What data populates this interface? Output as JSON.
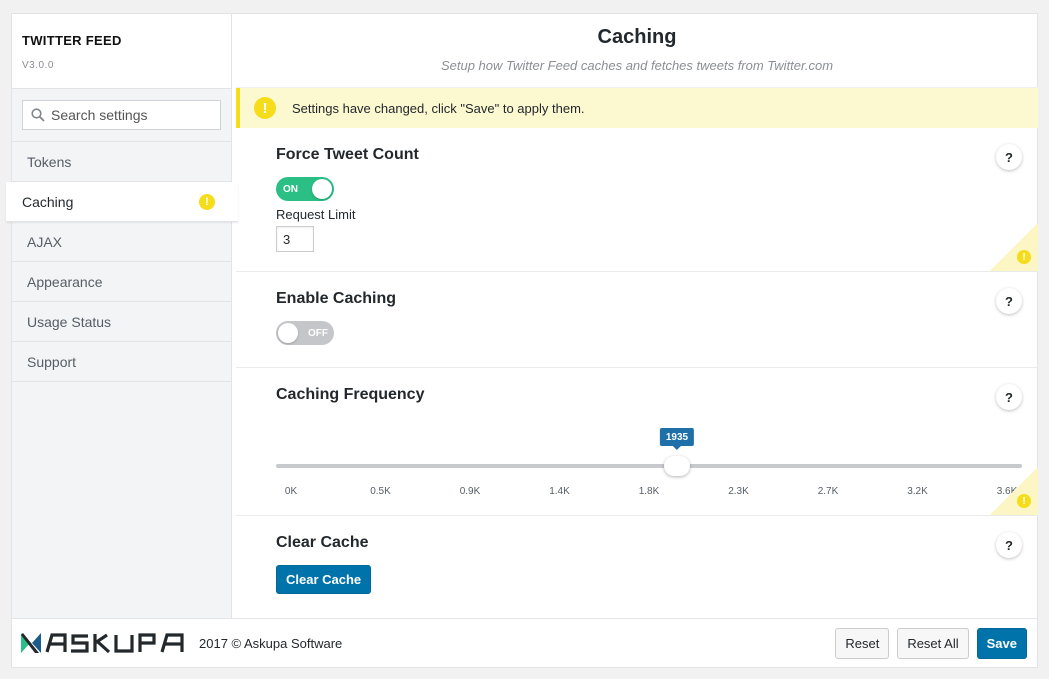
{
  "brand": {
    "title": "TWITTER FEED",
    "version": "V3.0.0"
  },
  "search": {
    "placeholder": "Search settings"
  },
  "sidebar": {
    "items": [
      {
        "label": "Tokens",
        "active": false
      },
      {
        "label": "Caching",
        "active": true,
        "warning": true
      },
      {
        "label": "AJAX",
        "active": false
      },
      {
        "label": "Appearance",
        "active": false
      },
      {
        "label": "Usage Status",
        "active": false
      },
      {
        "label": "Support",
        "active": false
      }
    ]
  },
  "header": {
    "title": "Caching",
    "subtitle": "Setup how Twitter Feed caches and fetches tweets from Twitter.com"
  },
  "notice": {
    "text": "Settings have changed, click \"Save\" to apply them.",
    "icon": "warning-icon"
  },
  "sections": {
    "force_tweet_count": {
      "title": "Force Tweet Count",
      "toggle_state": "ON",
      "request_limit_label": "Request Limit",
      "request_limit_value": "3",
      "help": "?"
    },
    "enable_caching": {
      "title": "Enable Caching",
      "toggle_state": "OFF",
      "help": "?"
    },
    "caching_frequency": {
      "title": "Caching Frequency",
      "help": "?",
      "slider": {
        "value": 1935,
        "display": "1935",
        "min": 0,
        "max": 3600,
        "ticks": [
          "0K",
          "0.5K",
          "0.9K",
          "1.4K",
          "1.8K",
          "2.3K",
          "2.7K",
          "3.2K",
          "3.6K"
        ]
      }
    },
    "clear_cache": {
      "title": "Clear Cache",
      "button_label": "Clear Cache",
      "help": "?"
    }
  },
  "footer": {
    "copyright": "2017 © Askupa Software",
    "reset_label": "Reset",
    "reset_all_label": "Reset All",
    "save_label": "Save"
  },
  "colors": {
    "accent": "#0073aa",
    "toggle_on": "#2bbf85",
    "warning": "#f5dd1c",
    "notice_bg": "#fcf8d0"
  }
}
